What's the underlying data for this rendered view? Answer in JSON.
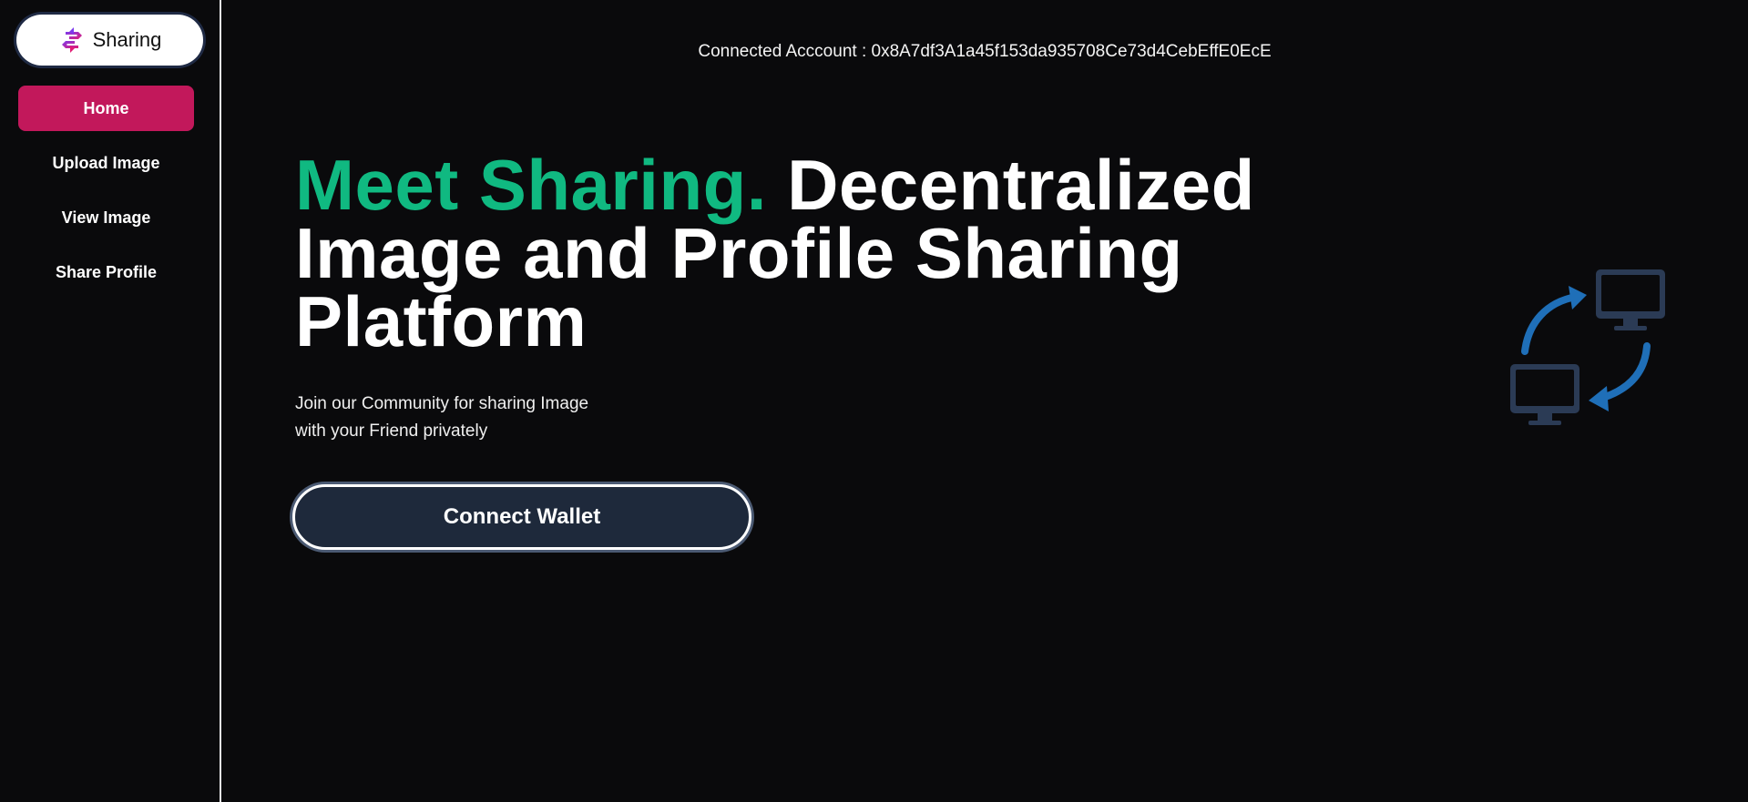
{
  "app": {
    "logo_text": "Sharing"
  },
  "sidebar": {
    "items": [
      {
        "label": "Home",
        "active": true
      },
      {
        "label": "Upload Image",
        "active": false
      },
      {
        "label": "View Image",
        "active": false
      },
      {
        "label": "Share Profile",
        "active": false
      }
    ]
  },
  "header": {
    "account_label": "Connected Acccount : 0x8A7df3A1a45f153da935708Ce73d4CebEffE0EcE"
  },
  "hero": {
    "headline_accent": "Meet Sharing.",
    "headline_rest": " Decentralized Image and Profile Sharing Platform",
    "subtext_line1": "Join our Community for sharing Image",
    "subtext_line2": "with your Friend privately",
    "cta_label": "Connect Wallet"
  },
  "colors": {
    "background": "#0a0a0c",
    "accent_green": "#10b981",
    "active_nav": "#c2185b",
    "button_bg": "#1e293b",
    "illustration_blue": "#1f6fb8",
    "illustration_monitor": "#2b3b55"
  },
  "icons": {
    "logo": "sharing-swap-logo-icon",
    "illustration": "computer-sync-arrows-icon"
  }
}
